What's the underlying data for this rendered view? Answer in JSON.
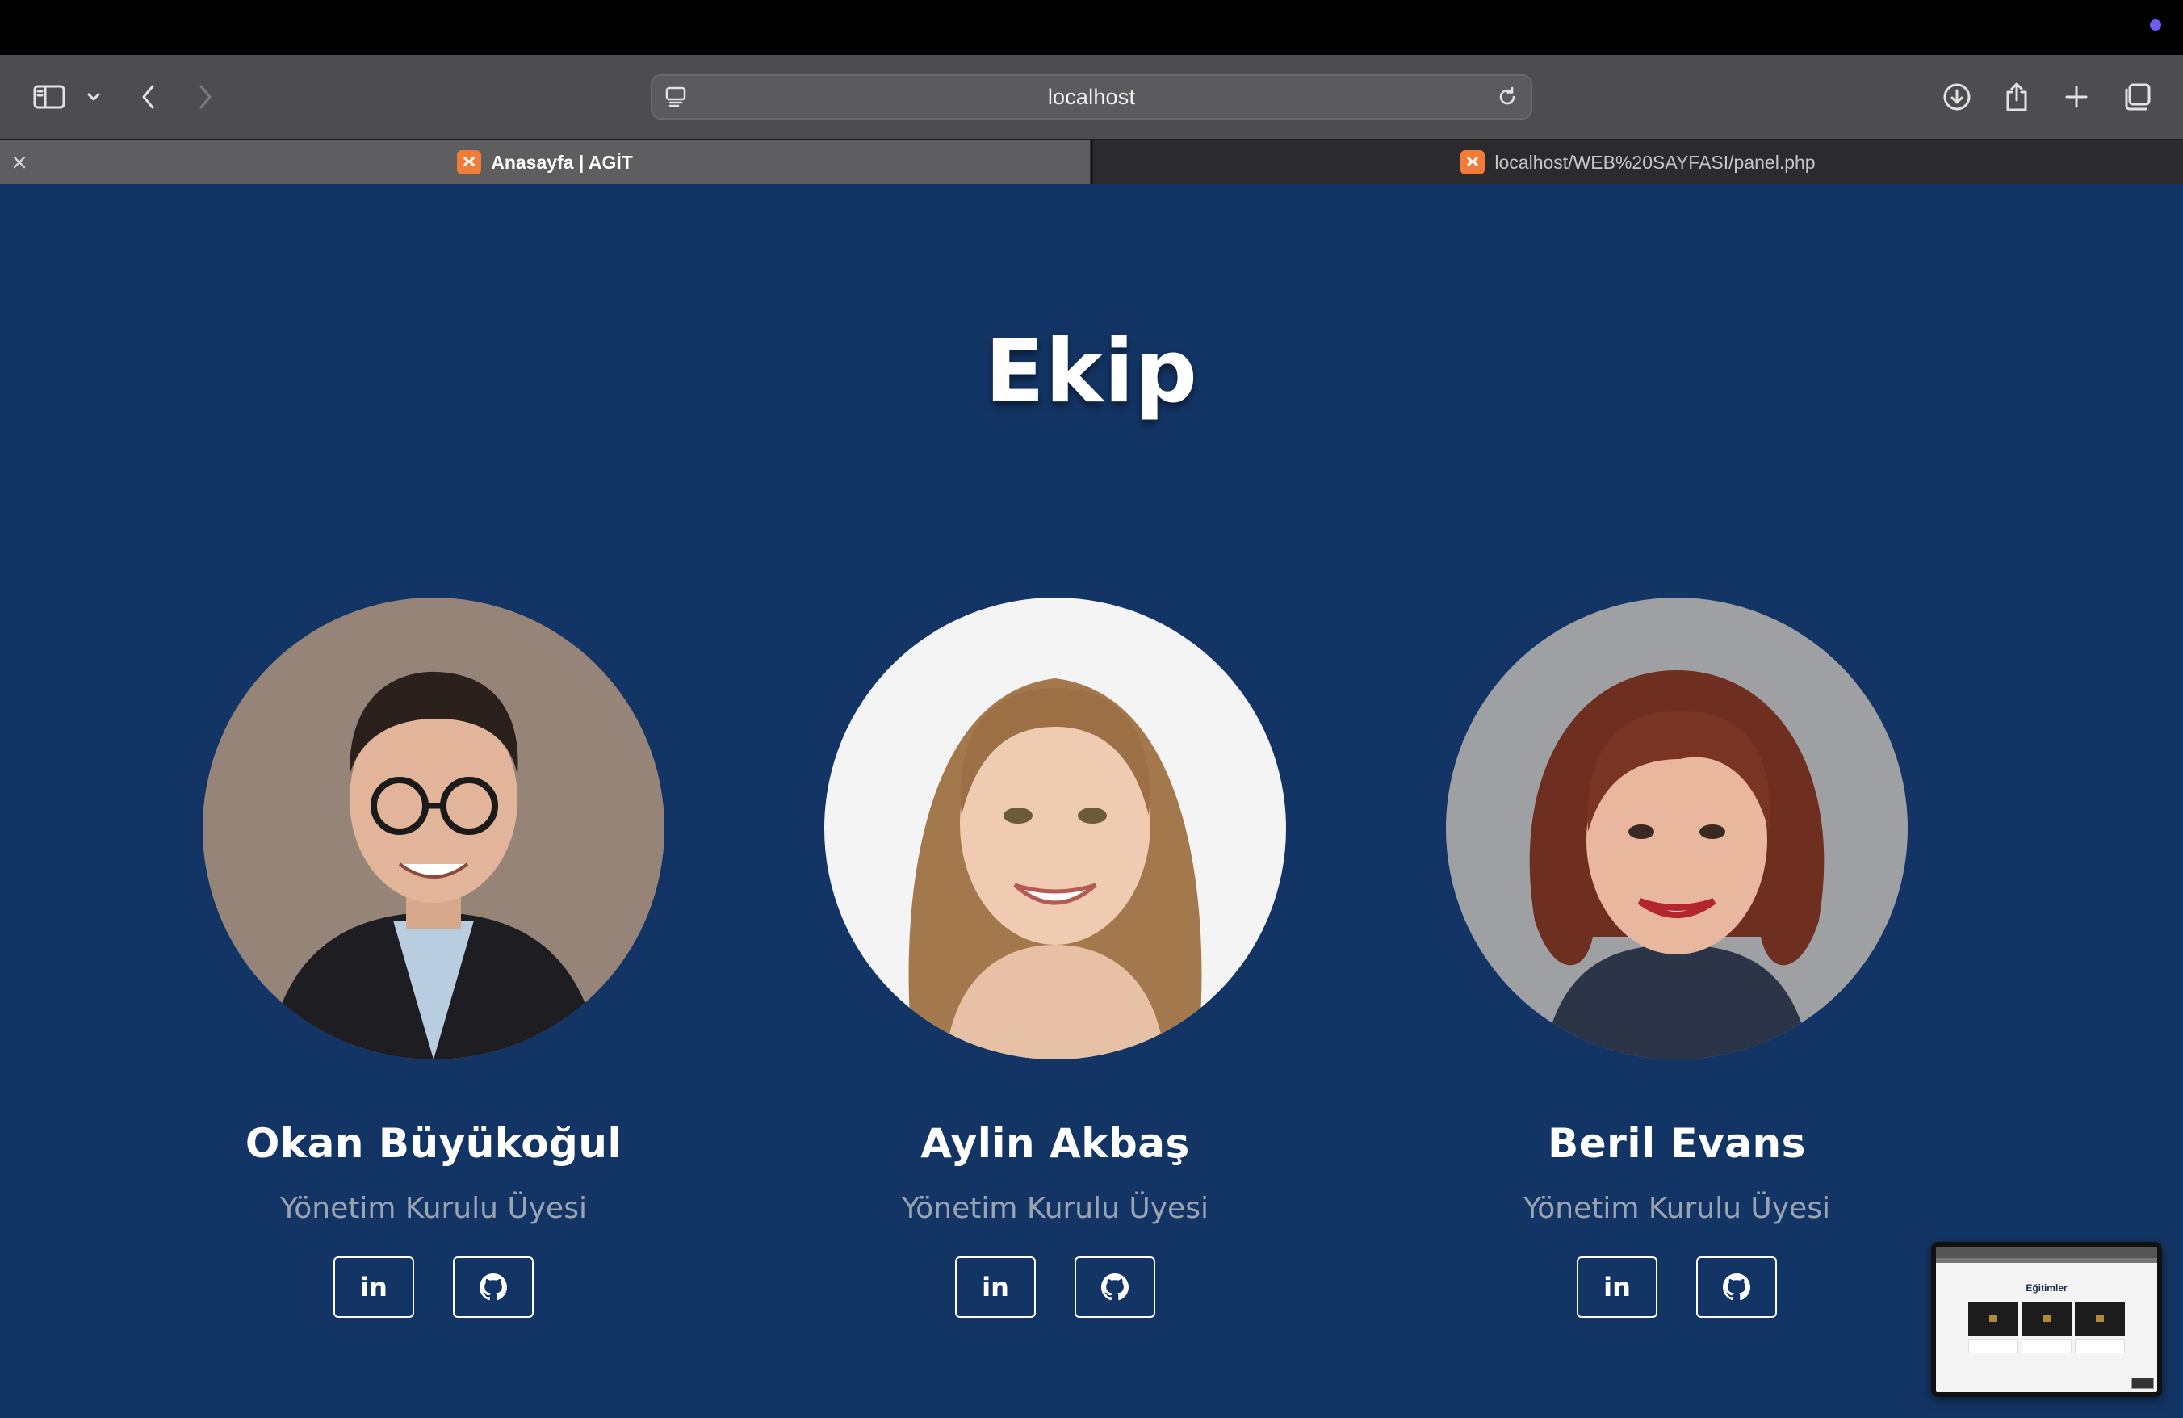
{
  "browser": {
    "url": "localhost",
    "tabs": [
      {
        "title": "Anasayfa | AGİT",
        "active": true
      },
      {
        "title": "localhost/WEB%20SAYFASI/panel.php",
        "active": false
      }
    ]
  },
  "page": {
    "background_color": "#133565",
    "section_title": "Ekip",
    "members": [
      {
        "name": "Okan Büyükoğul",
        "role": "Yönetim Kurulu Üyesi",
        "linkedin_label": "in",
        "github_icon": "github-icon"
      },
      {
        "name": "Aylin Akbaş",
        "role": "Yönetim Kurulu Üyesi",
        "linkedin_label": "in",
        "github_icon": "github-icon"
      },
      {
        "name": "Beril Evans",
        "role": "Yönetim Kurulu Üyesi",
        "linkedin_label": "in",
        "github_icon": "github-icon"
      }
    ]
  },
  "thumbnail": {
    "title": "Eğitimler"
  }
}
